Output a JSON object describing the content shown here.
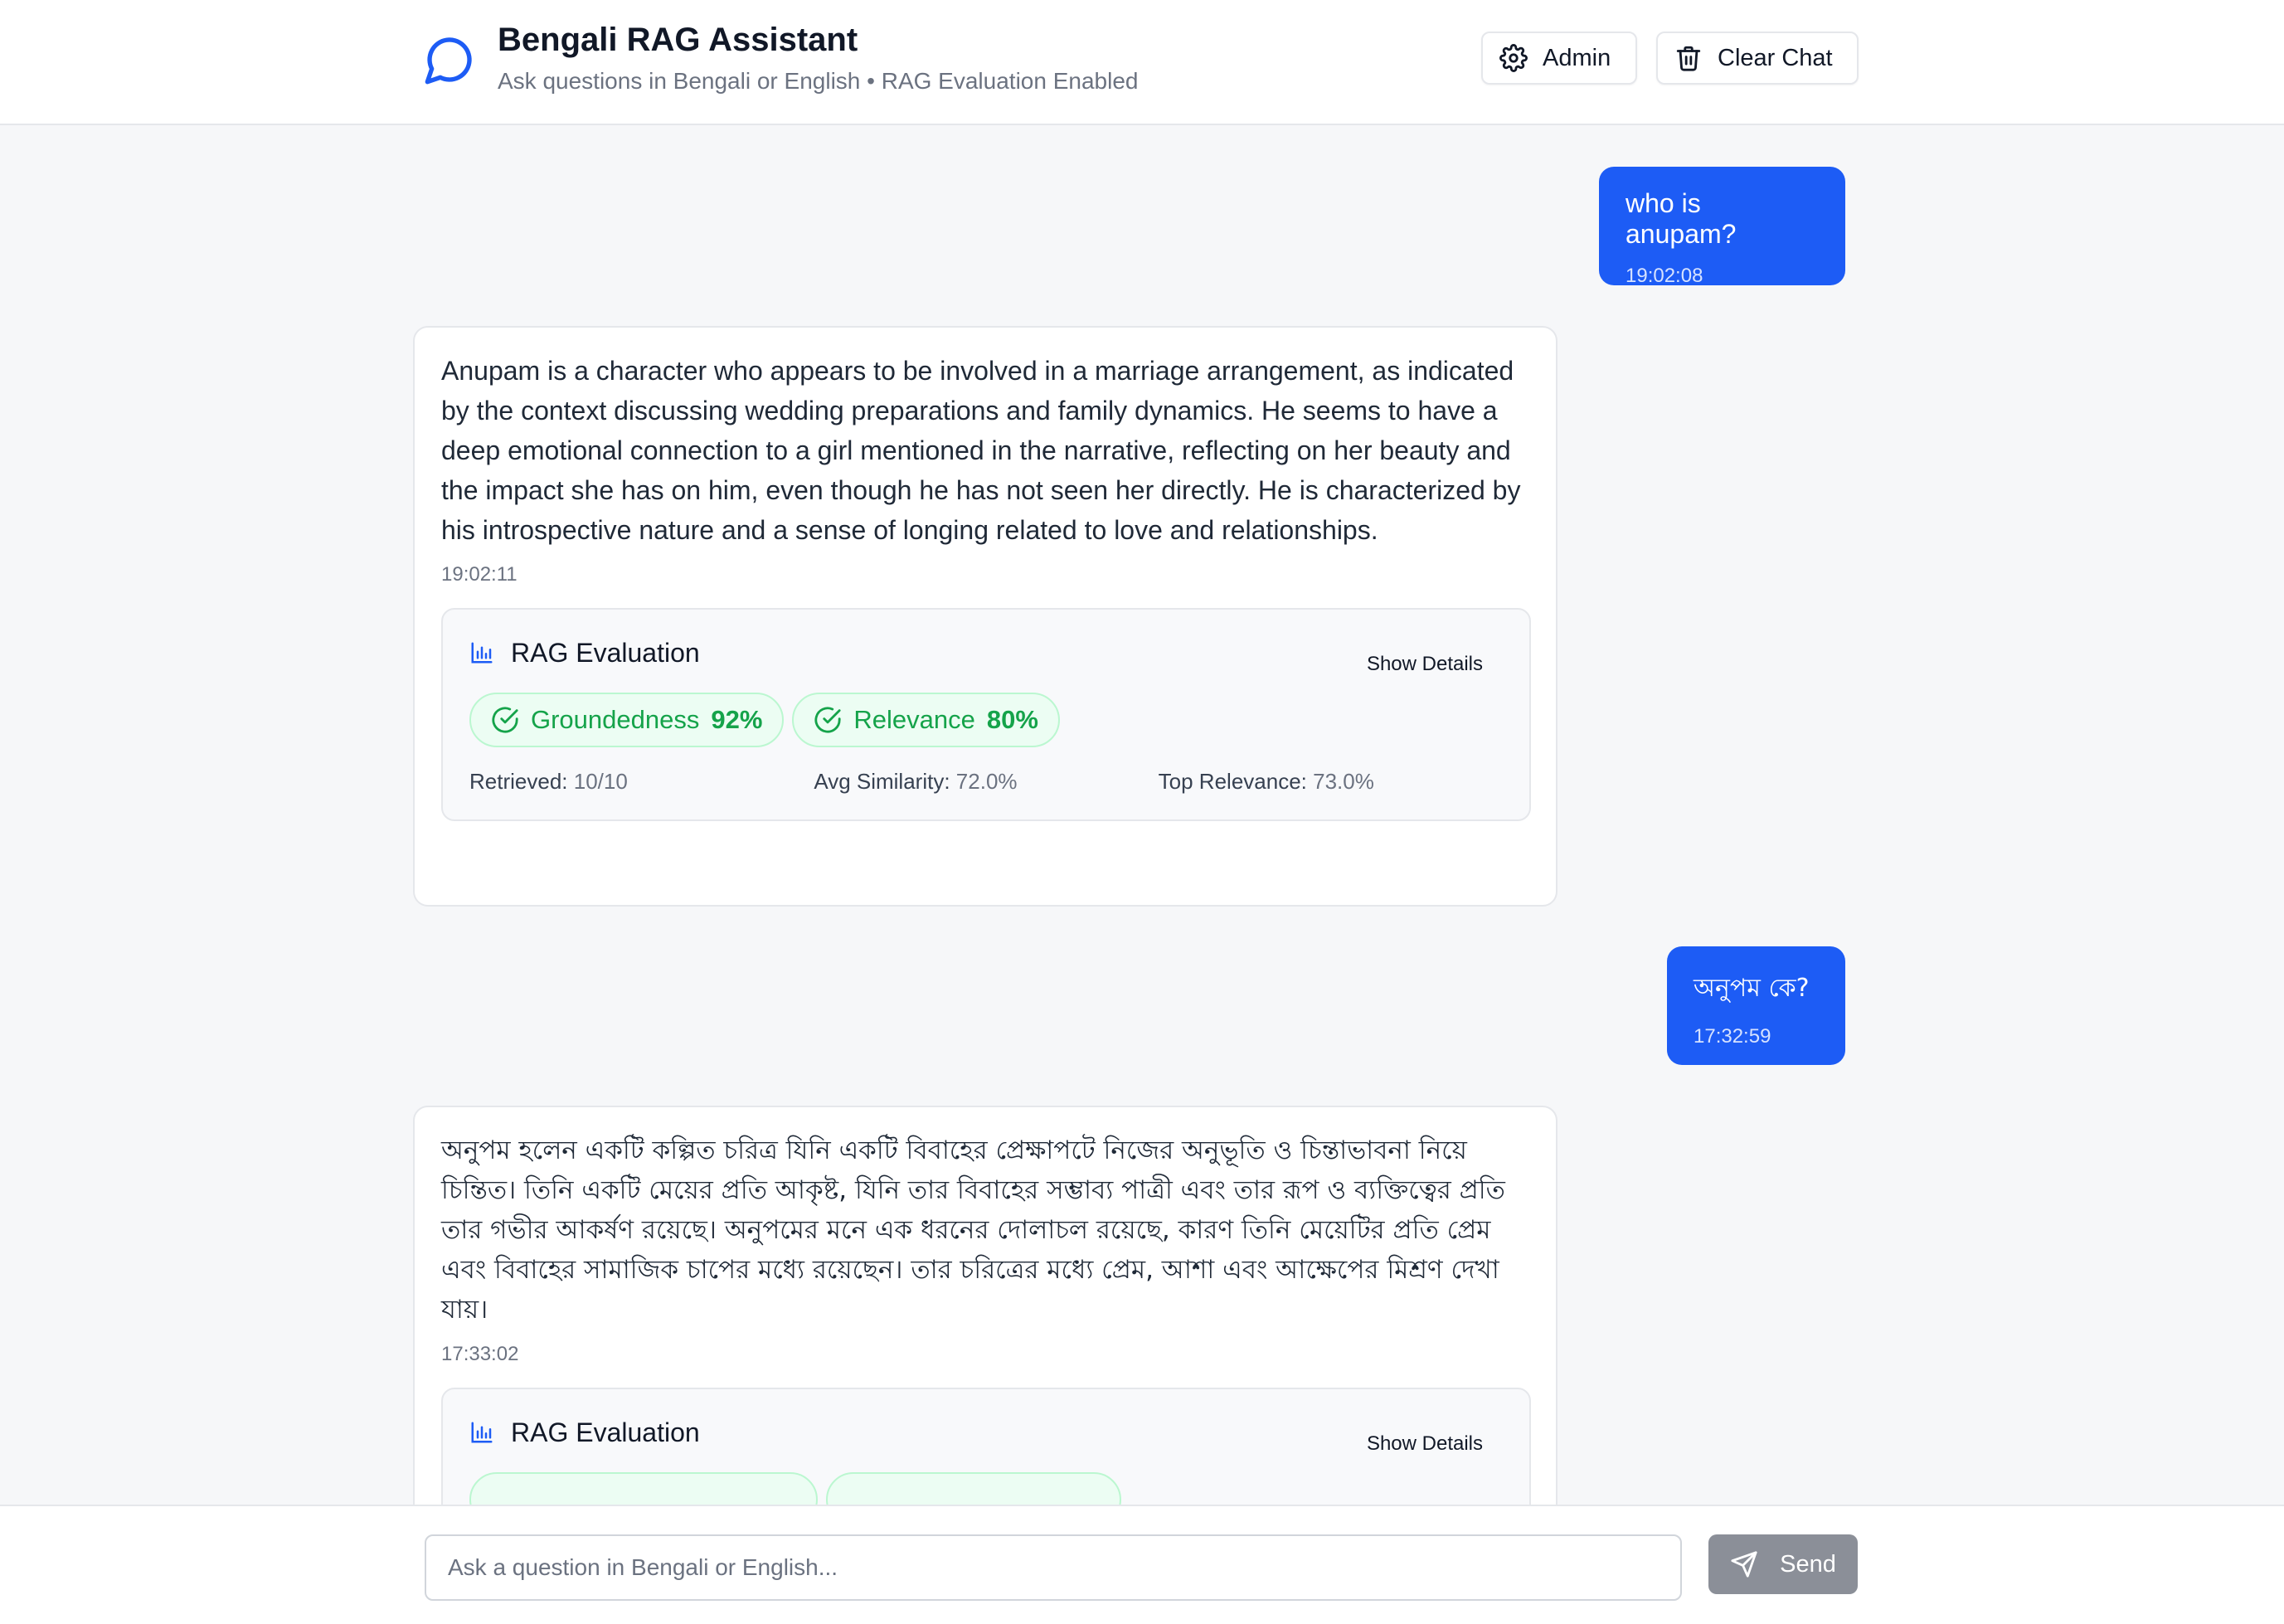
{
  "header": {
    "title": "Bengali RAG Assistant",
    "subtitle": "Ask questions in Bengali or English • RAG Evaluation Enabled",
    "admin_label": "Admin",
    "clear_label": "Clear Chat",
    "icons": {
      "logo": "chat-bubble-icon",
      "admin": "gear-icon",
      "clear": "trash-icon"
    },
    "accent_color": "#1d5cf5"
  },
  "messages": [
    {
      "role": "user",
      "text": "who is anupam?",
      "time": "19:02:08"
    },
    {
      "role": "assistant",
      "text": "Anupam is a character who appears to be involved in a marriage arrangement, as indicated by the context discussing wedding preparations and family dynamics. He seems to have a deep emotional connection to a girl mentioned in the narrative, reflecting on her beauty and the impact she has on him, even though he has not seen her directly. He is characterized by his introspective nature and a sense of longing related to love and relationships.",
      "time": "19:02:11",
      "evaluation": {
        "title": "RAG Evaluation",
        "show_details": "Show Details",
        "groundedness_label": "Groundedness",
        "groundedness": "92%",
        "relevance_label": "Relevance",
        "relevance": "80%",
        "retrieved_label": "Retrieved:",
        "retrieved": "10/10",
        "avg_similarity_label": "Avg Similarity:",
        "avg_similarity": "72.0%",
        "top_relevance_label": "Top Relevance:",
        "top_relevance": "73.0%"
      }
    },
    {
      "role": "user",
      "text": "অনুপম কে?",
      "time": "17:32:59"
    },
    {
      "role": "assistant",
      "text": "অনুপম হলেন একটি কল্পিত চরিত্র যিনি একটি বিবাহের প্রেক্ষাপটে নিজের অনুভূতি ও চিন্তাভাবনা নিয়ে চিন্তিত। তিনি একটি মেয়ের প্রতি আকৃষ্ট, যিনি তার বিবাহের সম্ভাব্য পাত্রী এবং তার রূপ ও ব্যক্তিত্বের প্রতি তার গভীর আকর্ষণ রয়েছে। অনুপমের মনে এক ধরনের দোলাচল রয়েছে, কারণ তিনি মেয়েটির প্রতি প্রেম এবং বিবাহের সামাজিক চাপের মধ্যে রয়েছেন। তার চরিত্রের মধ্যে প্রেম, আশা এবং আক্ষেপের মিশ্রণ দেখা যায়।",
      "time": "17:33:02",
      "evaluation": {
        "title": "RAG Evaluation",
        "show_details": "Show Details"
      }
    }
  ],
  "composer": {
    "placeholder": "Ask a question in Bengali or English...",
    "send_label": "Send",
    "send_icon": "send-icon"
  }
}
